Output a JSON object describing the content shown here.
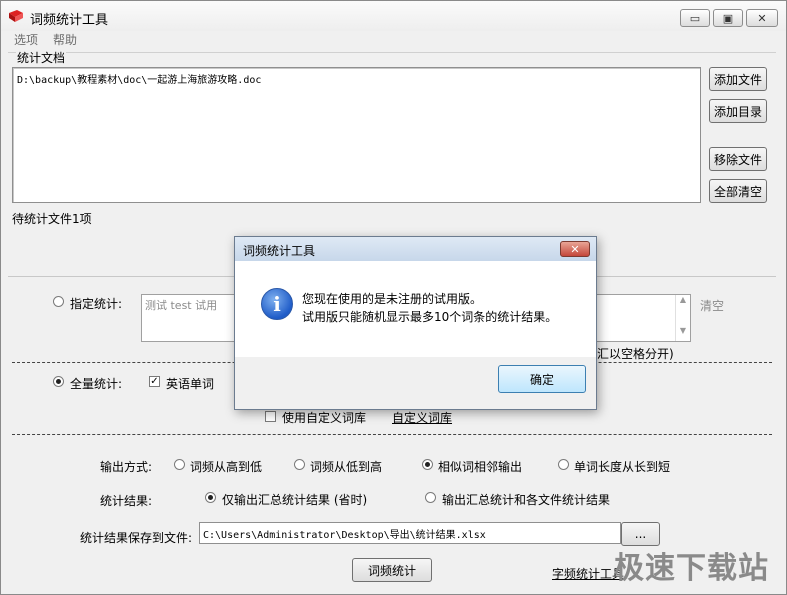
{
  "window": {
    "title": "词频统计工具",
    "min_glyph": "▭",
    "max_glyph": "▣",
    "close_glyph": "✕"
  },
  "menu": [
    "选项",
    "帮助"
  ],
  "doc_group": {
    "label": "统计文档",
    "files": [
      "D:\\backup\\教程素材\\doc\\一起游上海旅游攻略.doc"
    ],
    "pending": "待统计文件1项",
    "buttons": {
      "add_file": "添加文件",
      "add_dir": "添加目录",
      "remove_file": "移除文件",
      "clear_all": "全部清空"
    }
  },
  "stats": {
    "specified_label": "指定统计:",
    "specified_selected": false,
    "custom_placeholder": "测试 test 试用",
    "clear_link": "清空",
    "hint_tail": "汇以空格分开)",
    "full_label": "全量统计:",
    "full_selected": true,
    "english_words": {
      "label": "英语单词",
      "checked": true
    },
    "use_custom_dict": {
      "label": "使用自定义词库",
      "checked": false
    },
    "custom_dict_link": "自定义词库",
    "output_mode_label": "输出方式:",
    "output_modes": [
      {
        "label": "词频从高到低",
        "selected": false
      },
      {
        "label": "词频从低到高",
        "selected": false
      },
      {
        "label": "相似词相邻输出",
        "selected": true
      },
      {
        "label": "单词长度从长到短",
        "selected": false
      }
    ],
    "result_label": "统计结果:",
    "result_modes": [
      {
        "label": "仅输出汇总统计结果 (省时)",
        "selected": true
      },
      {
        "label": "输出汇总统计和各文件统计结果",
        "selected": false
      }
    ],
    "save_label": "统计结果保存到文件:",
    "save_path": "C:\\Users\\Administrator\\Desktop\\导出\\统计结果.xlsx",
    "browse_label": "...",
    "run_button": "词频统计",
    "char_freq_link": "字频统计工具"
  },
  "dialog": {
    "title": "词频统计工具",
    "close_glyph": "✕",
    "icon_glyph": "i",
    "line1": "您现在使用的是未注册的试用版。",
    "line2": "试用版只能随机显示最多10个词条的统计结果。",
    "ok_label": "确定"
  },
  "watermark": "极速下载站"
}
